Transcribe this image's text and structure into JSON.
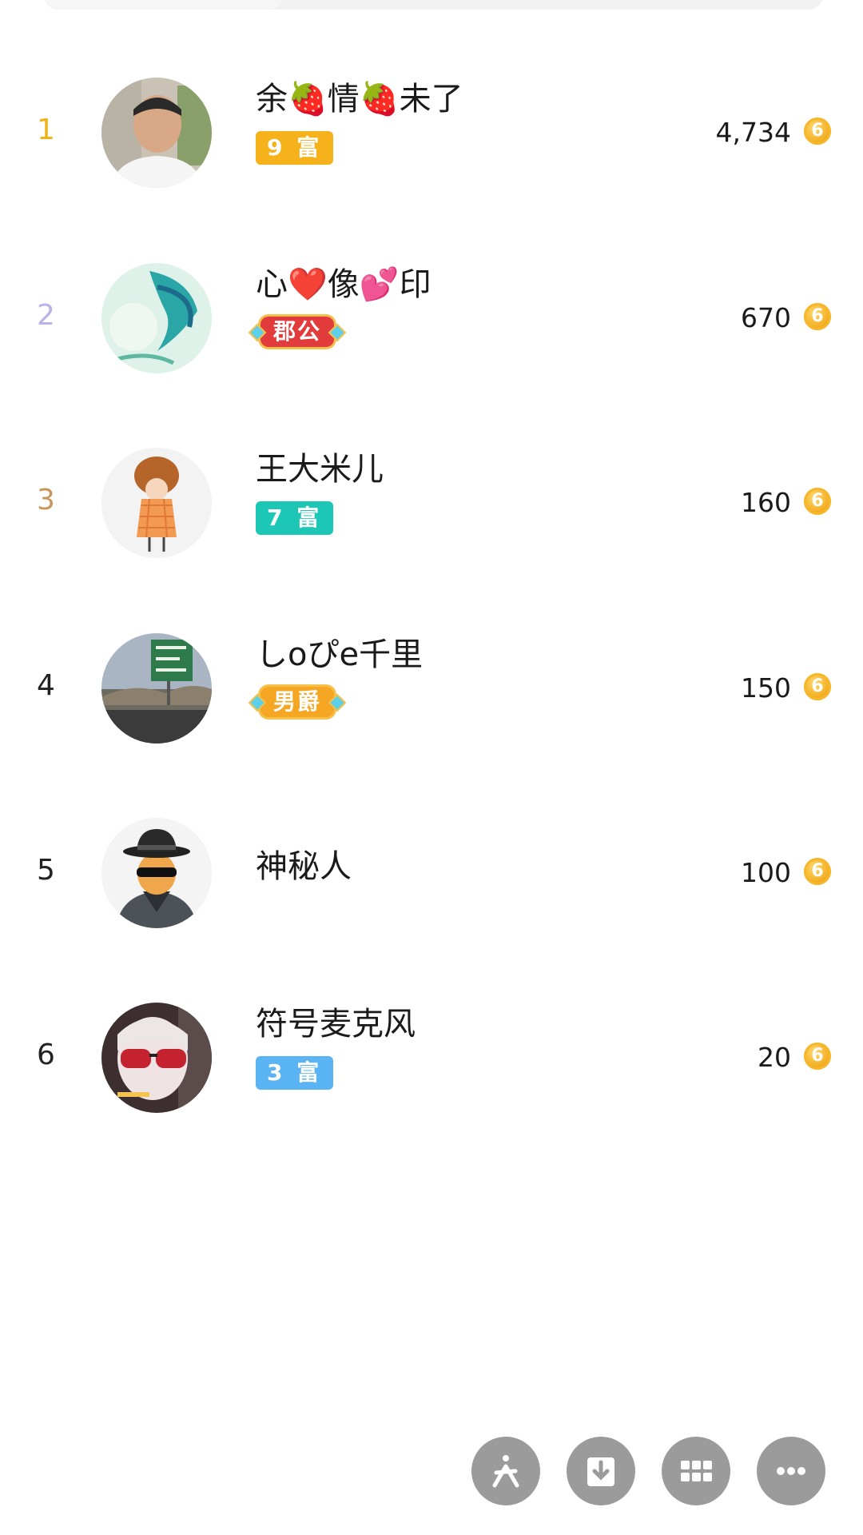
{
  "leaderboard": [
    {
      "rank": "1",
      "name": "余🍓情🍓未了",
      "badge": "9 富",
      "badge_type": "wealth",
      "badge_color": "#f5b21b",
      "score": "4,734",
      "rank_color": "#f0b21a"
    },
    {
      "rank": "2",
      "name": "心❤️像💕印",
      "badge": "郡公",
      "badge_type": "noble",
      "badge_color": "#e23b3b",
      "score": "670",
      "rank_color": "#b9b3e8"
    },
    {
      "rank": "3",
      "name": "王大米儿",
      "badge": "7 富",
      "badge_type": "wealth",
      "badge_color": "#1cc7b6",
      "score": "160",
      "rank_color": "#c8955a"
    },
    {
      "rank": "4",
      "name": "しoぴe千里",
      "badge": "男爵",
      "badge_type": "noble",
      "badge_color": "#f5a623",
      "score": "150",
      "rank_color": "#222222"
    },
    {
      "rank": "5",
      "name": "神秘人",
      "badge": "",
      "badge_type": "none",
      "badge_color": "",
      "score": "100",
      "rank_color": "#222222"
    },
    {
      "rank": "6",
      "name": "符号麦克风",
      "badge": "3 富",
      "badge_type": "wealth",
      "badge_color": "#5ab3f3",
      "score": "20",
      "rank_color": "#222222"
    }
  ],
  "coin_icon": "coin-icon",
  "coin_glyph": "6",
  "bottom_actions": [
    {
      "name": "kuaishou-share-button",
      "icon": "kuaishou-icon"
    },
    {
      "name": "download-button",
      "icon": "download-icon"
    },
    {
      "name": "apps-button",
      "icon": "grid-icon"
    },
    {
      "name": "more-button",
      "icon": "more-icon"
    }
  ]
}
